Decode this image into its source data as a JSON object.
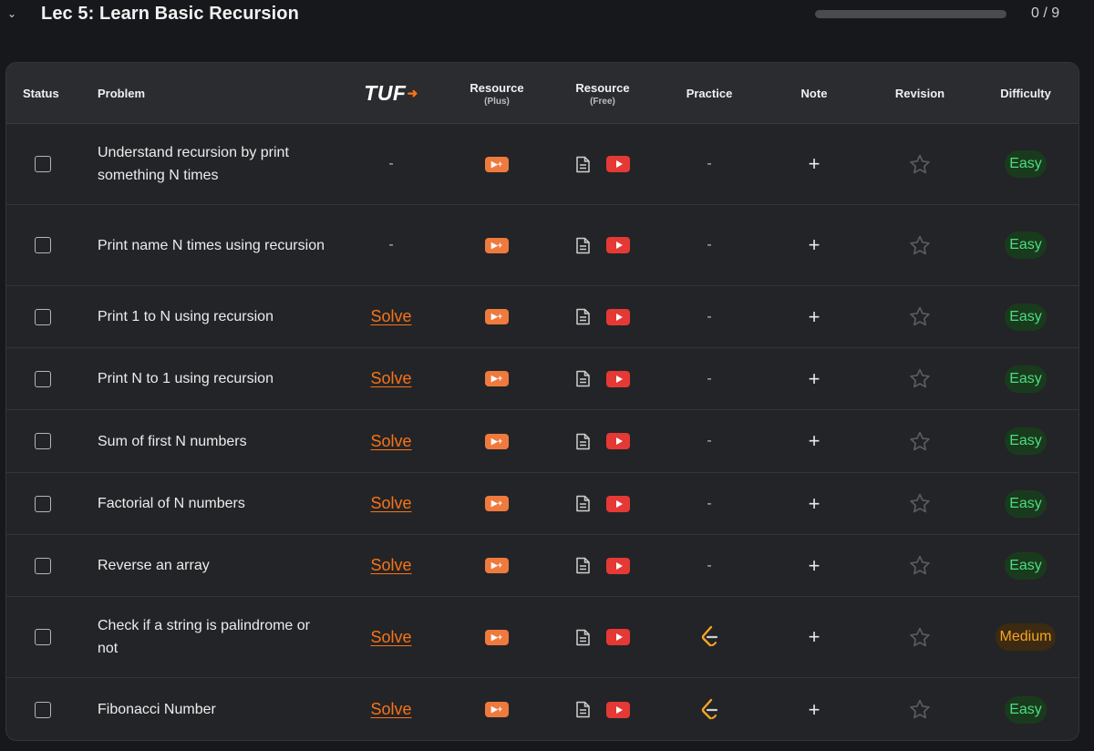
{
  "lecture": {
    "chevron_icon": "chevron-down-icon",
    "title": "Lec 5: Learn Basic Recursion",
    "progress_fraction": 0,
    "progress_label": "0 / 9"
  },
  "colors": {
    "accent": "#f97316",
    "easy": "#4ade80",
    "medium": "#f5a524",
    "youtube": "#e53935"
  },
  "table": {
    "headers": {
      "status": "Status",
      "problem": "Problem",
      "tuf": "TUF",
      "resource_plus": "Resource",
      "resource_plus_sub": "(Plus)",
      "resource_free": "Resource",
      "resource_free_sub": "(Free)",
      "practice": "Practice",
      "note": "Note",
      "revision": "Revision",
      "difficulty": "Difficulty"
    },
    "rows": [
      {
        "problem": "Understand recursion by print something N times",
        "tuf": "-",
        "practice": "-",
        "practice_icon": false,
        "note": "+",
        "difficulty": "Easy",
        "level": "easy"
      },
      {
        "problem": "Print name N times using recursion",
        "tuf": "-",
        "practice": "-",
        "practice_icon": false,
        "note": "+",
        "difficulty": "Easy",
        "level": "easy"
      },
      {
        "problem": "Print 1 to N using recursion",
        "tuf": "Solve",
        "practice": "-",
        "practice_icon": false,
        "note": "+",
        "difficulty": "Easy",
        "level": "easy"
      },
      {
        "problem": "Print N to 1 using recursion",
        "tuf": "Solve",
        "practice": "-",
        "practice_icon": false,
        "note": "+",
        "difficulty": "Easy",
        "level": "easy"
      },
      {
        "problem": "Sum of first N numbers",
        "tuf": "Solve",
        "practice": "-",
        "practice_icon": false,
        "note": "+",
        "difficulty": "Easy",
        "level": "easy"
      },
      {
        "problem": "Factorial of N numbers",
        "tuf": "Solve",
        "practice": "-",
        "practice_icon": false,
        "note": "+",
        "difficulty": "Easy",
        "level": "easy"
      },
      {
        "problem": "Reverse an array",
        "tuf": "Solve",
        "practice": "-",
        "practice_icon": false,
        "note": "+",
        "difficulty": "Easy",
        "level": "easy"
      },
      {
        "problem": "Check if a string is palindrome or not",
        "tuf": "Solve",
        "practice": "",
        "practice_icon": true,
        "note": "+",
        "difficulty": "Medium",
        "level": "medium"
      },
      {
        "problem": "Fibonacci Number",
        "tuf": "Solve",
        "practice": "",
        "practice_icon": true,
        "note": "+",
        "difficulty": "Easy",
        "level": "easy"
      }
    ]
  },
  "icons": {
    "plus_resource": "play-plus-icon",
    "article": "document-icon",
    "video": "youtube-icon",
    "practice": "leetcode-icon",
    "note": "plus-icon",
    "revision": "star-icon"
  }
}
